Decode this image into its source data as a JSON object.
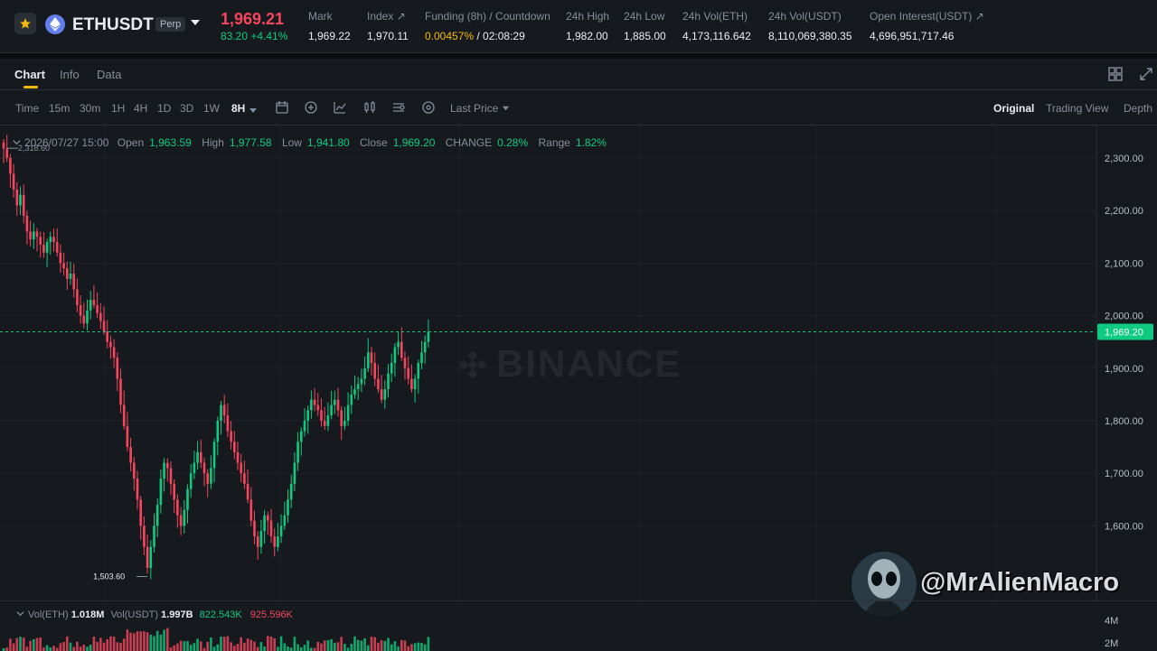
{
  "header": {
    "symbol": "ETHUSDT",
    "contract_badge": "Perp",
    "last_price": "1,969.21",
    "change": "83.20 +4.41%",
    "stats": [
      {
        "label": "Mark",
        "value": "1,969.22"
      },
      {
        "label": "Index ↗",
        "value": "1,970.11"
      },
      {
        "label": "Funding (8h) / Countdown",
        "value_rate": "0.00457%",
        "value_countdown": " / 02:08:29"
      },
      {
        "label": "24h High",
        "value": "1,982.00"
      },
      {
        "label": "24h Low",
        "value": "1,885.00"
      },
      {
        "label": "24h Vol(ETH)",
        "value": "4,173,116.642"
      },
      {
        "label": "24h Vol(USDT)",
        "value": "8,110,069,380.35"
      },
      {
        "label": "Open Interest(USDT) ↗",
        "value": "4,696,951,717.46"
      }
    ]
  },
  "tabs": [
    "Chart",
    "Info",
    "Data"
  ],
  "toolbar": {
    "timeframes": [
      "Time",
      "15m",
      "30m",
      "1H",
      "4H",
      "1D",
      "3D",
      "1W",
      "8H"
    ],
    "active_timeframe": "8H",
    "price_type": "Last Price",
    "views": [
      "Original",
      "Trading View",
      "Depth"
    ],
    "active_view": "Original"
  },
  "ohlc": {
    "date": "2026/07/27 15:00",
    "open_label": "Open",
    "open": "1,963.59",
    "high_label": "High",
    "high": "1,977.58",
    "low_label": "Low",
    "low": "1,941.80",
    "close_label": "Close",
    "close": "1,969.20",
    "change_label": "CHANGE",
    "change": "0.28%",
    "range_label": "Range",
    "range": "1.82%"
  },
  "watermark": "BINANCE",
  "branding": {
    "handle": "@MrAlienMacro"
  },
  "volume": {
    "label_eth": "Vol(ETH)",
    "value_eth": "1.018M",
    "label_usdt": "Vol(USDT)",
    "value_usdt": "1.997B",
    "ma1": "822.543K",
    "ma2": "925.596K",
    "axis_labels": [
      "4M",
      "2M"
    ]
  },
  "colors": {
    "up": "#0ecb81",
    "down": "#f6465d",
    "accent": "#f0b90b",
    "bg": "#161a1e"
  },
  "chart_data": {
    "type": "candlestick",
    "title": "",
    "y_ticks": [
      1600,
      1700,
      1800,
      1900,
      2000,
      2100,
      2200,
      2300
    ],
    "y_tick_labels": [
      "1,600.00",
      "1,700.00",
      "1,800.00",
      "1,900.00",
      "2,000.00",
      "2,100.00",
      "2,200.00",
      "2,300.00"
    ],
    "ylim": [
      1505,
      2330
    ],
    "max_label": "2,318.60",
    "min_label": "1,503.60",
    "last_price": 1969.2,
    "last_price_label": "1,969.20",
    "grid": true,
    "closes": [
      2318,
      2300,
      2270,
      2240,
      2210,
      2230,
      2190,
      2160,
      2145,
      2160,
      2150,
      2135,
      2120,
      2140,
      2150,
      2140,
      2120,
      2100,
      2090,
      2070,
      2080,
      2050,
      2020,
      2000,
      1985,
      2010,
      2030,
      2020,
      2005,
      1990,
      1970,
      1950,
      1940,
      1920,
      1880,
      1830,
      1790,
      1750,
      1720,
      1690,
      1650,
      1600,
      1560,
      1520,
      1560,
      1600,
      1640,
      1690,
      1720,
      1710,
      1680,
      1650,
      1620,
      1600,
      1630,
      1670,
      1700,
      1720,
      1740,
      1720,
      1700,
      1680,
      1710,
      1760,
      1800,
      1830,
      1810,
      1780,
      1760,
      1740,
      1720,
      1700,
      1680,
      1650,
      1610,
      1580,
      1560,
      1590,
      1620,
      1610,
      1580,
      1560,
      1580,
      1600,
      1620,
      1650,
      1680,
      1720,
      1760,
      1780,
      1800,
      1820,
      1840,
      1830,
      1820,
      1800,
      1790,
      1810,
      1830,
      1840,
      1820,
      1790,
      1800,
      1830,
      1850,
      1860,
      1870,
      1880,
      1900,
      1930,
      1910,
      1880,
      1860,
      1840,
      1860,
      1890,
      1910,
      1940,
      1950,
      1920,
      1900,
      1880,
      1860,
      1880,
      1910,
      1930,
      1950,
      1969
    ]
  }
}
